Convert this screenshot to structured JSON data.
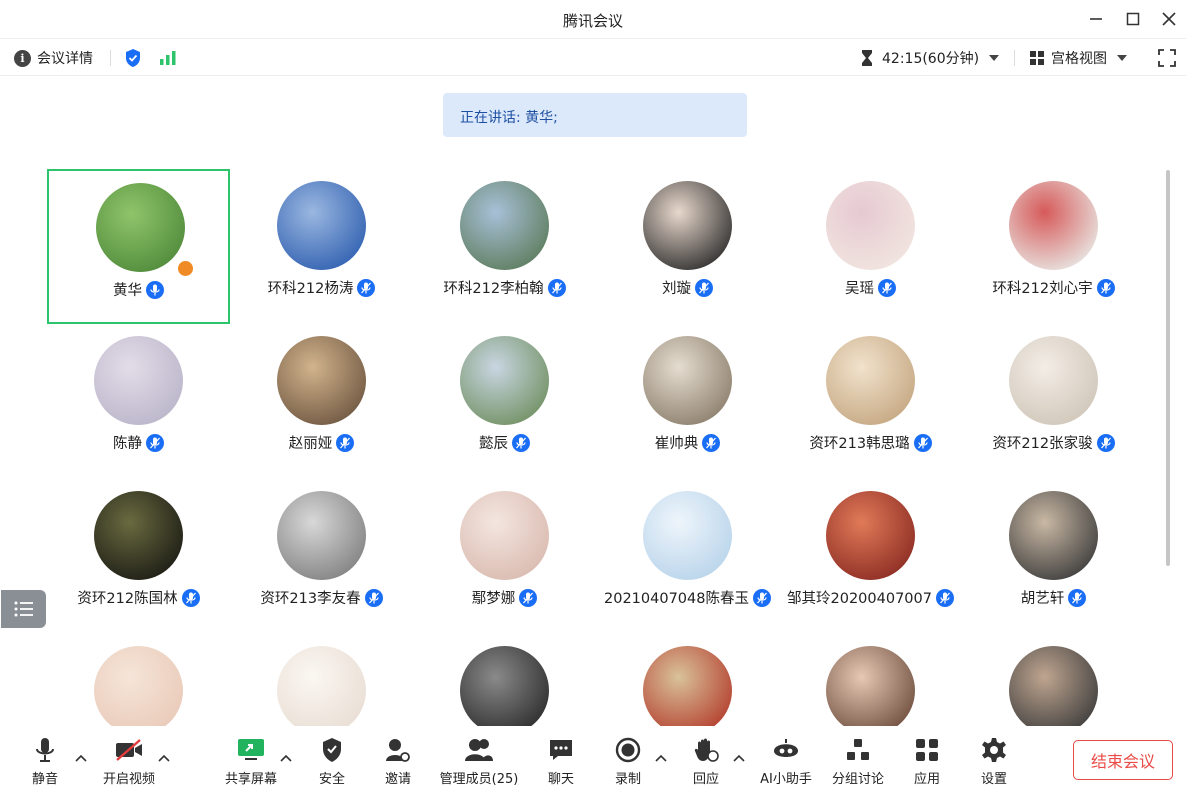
{
  "window": {
    "title": "腾讯会议"
  },
  "topbar": {
    "meeting_details": "会议详情",
    "timer": "42:15(60分钟)",
    "view_mode": "宫格视图"
  },
  "speaking_banner": "正在讲话: 黄华;",
  "participants": [
    {
      "name": "黄华",
      "mic": "active",
      "host": true,
      "avatar_colors": [
        "#4f8a3a",
        "#8fc46a"
      ]
    },
    {
      "name": "环科212杨涛",
      "mic": "muted",
      "avatar_colors": [
        "#2f5fb0",
        "#9ab7e0"
      ]
    },
    {
      "name": "环科212李柏翰",
      "mic": "muted",
      "avatar_colors": [
        "#5b7b5a",
        "#a8c0d8"
      ]
    },
    {
      "name": "刘璇",
      "mic": "muted",
      "avatar_colors": [
        "#2a2a2a",
        "#e8d8cc"
      ]
    },
    {
      "name": "吴瑶",
      "mic": "muted",
      "avatar_colors": [
        "#f2e6e0",
        "#e6c9d2"
      ]
    },
    {
      "name": "环科212刘心宇",
      "mic": "muted",
      "avatar_colors": [
        "#e9ece8",
        "#d65a5a"
      ]
    },
    {
      "name": "陈静",
      "mic": "muted",
      "avatar_colors": [
        "#b9b4c9",
        "#e3dce8"
      ]
    },
    {
      "name": "赵丽娅",
      "mic": "muted",
      "avatar_colors": [
        "#6d5540",
        "#d2b48c"
      ]
    },
    {
      "name": "懿辰",
      "mic": "muted",
      "avatar_colors": [
        "#6f8f60",
        "#c9d6e2"
      ]
    },
    {
      "name": "崔帅典",
      "mic": "muted",
      "avatar_colors": [
        "#8a7c6a",
        "#e5ddd0"
      ]
    },
    {
      "name": "资环213韩思璐",
      "mic": "muted",
      "avatar_colors": [
        "#c4a680",
        "#f1e2cc"
      ]
    },
    {
      "name": "资环212张家骏",
      "mic": "muted",
      "avatar_colors": [
        "#cfc5b8",
        "#f3ede6"
      ]
    },
    {
      "name": "资环212陈国林",
      "mic": "muted",
      "avatar_colors": [
        "#1a1a14",
        "#6a6a40"
      ]
    },
    {
      "name": "资环213李友春",
      "mic": "muted",
      "avatar_colors": [
        "#7f7f7f",
        "#d8d8d8"
      ]
    },
    {
      "name": "鄢梦娜",
      "mic": "muted",
      "avatar_colors": [
        "#d9b9ae",
        "#f3e6e0"
      ]
    },
    {
      "name": "20210407048陈春玉",
      "mic": "muted",
      "avatar_colors": [
        "#b7d3ea",
        "#eef5fb"
      ]
    },
    {
      "name": "邹其玲20200407007",
      "mic": "muted",
      "avatar_colors": [
        "#8a2a22",
        "#e07a58"
      ]
    },
    {
      "name": "胡艺轩",
      "mic": "muted",
      "avatar_colors": [
        "#3a3a3a",
        "#c9b8a4"
      ]
    },
    {
      "name": "",
      "mic": "none",
      "avatar_colors": [
        "#e9c9b8",
        "#f5e5d8"
      ]
    },
    {
      "name": "",
      "mic": "none",
      "avatar_colors": [
        "#e8ddd3",
        "#fbf7f2"
      ]
    },
    {
      "name": "",
      "mic": "none",
      "avatar_colors": [
        "#2a2a2a",
        "#8a8a8a"
      ]
    },
    {
      "name": "",
      "mic": "none",
      "avatar_colors": [
        "#b23a2a",
        "#d9c29a"
      ]
    },
    {
      "name": "",
      "mic": "none",
      "avatar_colors": [
        "#6b4a3a",
        "#e6c8b4"
      ]
    },
    {
      "name": "",
      "mic": "none",
      "avatar_colors": [
        "#3a3a3a",
        "#bfa590"
      ]
    }
  ],
  "bottombar": {
    "mute": "静音",
    "start_video": "开启视频",
    "share_screen": "共享屏幕",
    "security": "安全",
    "invite": "邀请",
    "manage_members": "管理成员(25)",
    "chat": "聊天",
    "record": "录制",
    "reaction": "回应",
    "ai_assistant": "AI小助手",
    "breakout": "分组讨论",
    "apps": "应用",
    "settings": "设置",
    "end_meeting": "结束会议"
  },
  "colors": {
    "accent_blue": "#1a6ef5",
    "active_border": "#2ec46b",
    "end_red": "#ea4b47",
    "share_green": "#22b35e"
  }
}
